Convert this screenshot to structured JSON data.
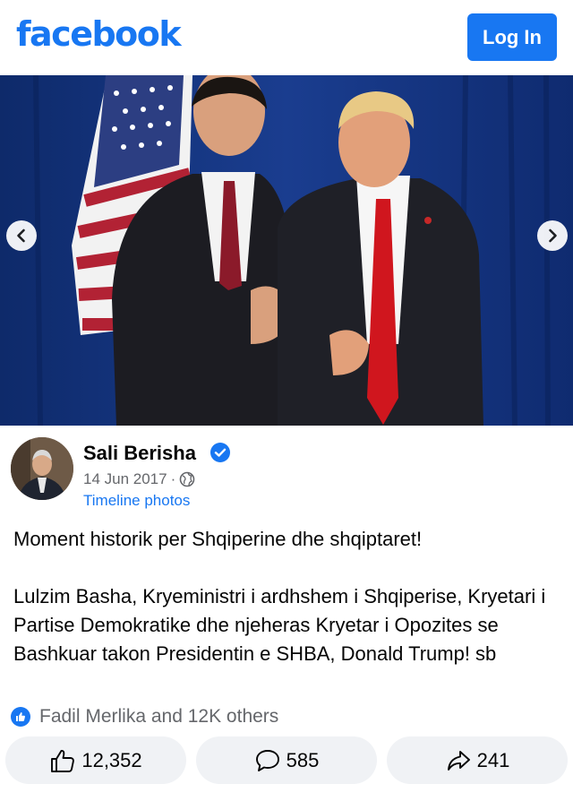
{
  "header": {
    "logo_text": "facebook",
    "login_label": "Log In",
    "brand_color": "#1877f2"
  },
  "photo": {
    "prev_icon": "chevron-left-icon",
    "next_icon": "chevron-right-icon"
  },
  "post": {
    "author": "Sali Berisha",
    "verified": true,
    "date": "14 Jun 2017",
    "separator": "·",
    "privacy_icon": "globe-icon",
    "album": "Timeline photos",
    "paragraphs": [
      "Moment historik per Shqiperine dhe shqiptaret!",
      "Lulzim Basha, Kryeministri i ardhshem i Shqiperise, Kryetari i Partise Demokratike dhe njeheras Kryetar i Opozites se Bashkuar takon Presidentin e SHBA, Donald Trump! sb"
    ]
  },
  "reactions": {
    "summary": "Fadil Merlika and 12K others"
  },
  "actions": {
    "likes": "12,352",
    "comments": "585",
    "shares": "241"
  }
}
